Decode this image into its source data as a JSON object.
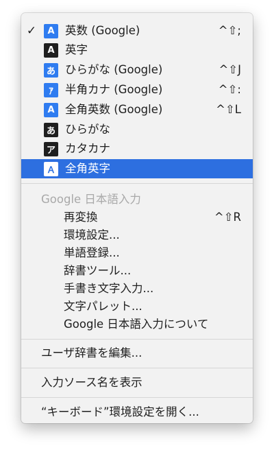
{
  "input_methods": [
    {
      "label": "英数 (Google)",
      "icon_char": "A",
      "icon_color": "blue",
      "checked": true,
      "selected": false,
      "shortcut": "^⇧;"
    },
    {
      "label": "英字",
      "icon_char": "A",
      "icon_color": "black",
      "checked": false,
      "selected": false,
      "shortcut": ""
    },
    {
      "label": "ひらがな (Google)",
      "icon_char": "あ",
      "icon_color": "blue",
      "checked": false,
      "selected": false,
      "shortcut": "^⇧J"
    },
    {
      "label": "半角カナ (Google)",
      "icon_char": "ｱ",
      "icon_color": "blue",
      "checked": false,
      "selected": false,
      "shortcut": "^⇧:"
    },
    {
      "label": "全角英数 (Google)",
      "icon_char": "A",
      "icon_color": "blue",
      "checked": false,
      "selected": false,
      "shortcut": "^⇧L"
    },
    {
      "label": "ひらがな",
      "icon_char": "あ",
      "icon_color": "black",
      "checked": false,
      "selected": false,
      "shortcut": ""
    },
    {
      "label": "カタカナ",
      "icon_char": "ア",
      "icon_color": "black",
      "checked": false,
      "selected": false,
      "shortcut": ""
    },
    {
      "label": "全角英字",
      "icon_char": "Ａ",
      "icon_color": "blue",
      "checked": false,
      "selected": true,
      "shortcut": ""
    }
  ],
  "checkmark": "✓",
  "google_section": {
    "header": "Google 日本語入力",
    "items": [
      {
        "label": "再変換",
        "shortcut": "^⇧R"
      },
      {
        "label": "環境設定...",
        "shortcut": ""
      },
      {
        "label": "単語登録...",
        "shortcut": ""
      },
      {
        "label": "辞書ツール...",
        "shortcut": ""
      },
      {
        "label": "手書き文字入力...",
        "shortcut": ""
      },
      {
        "label": "文字パレット...",
        "shortcut": ""
      },
      {
        "label": "Google 日本語入力について",
        "shortcut": ""
      }
    ]
  },
  "edit_dictionary": "ユーザ辞書を編集...",
  "show_input_source_name": "入力ソース名を表示",
  "open_keyboard_prefs": "“キーボード”環境設定を開く...",
  "colors": {
    "highlight": "#2d6fe0",
    "icon_blue": "#2f7cf0",
    "icon_black": "#1f1f1f"
  }
}
